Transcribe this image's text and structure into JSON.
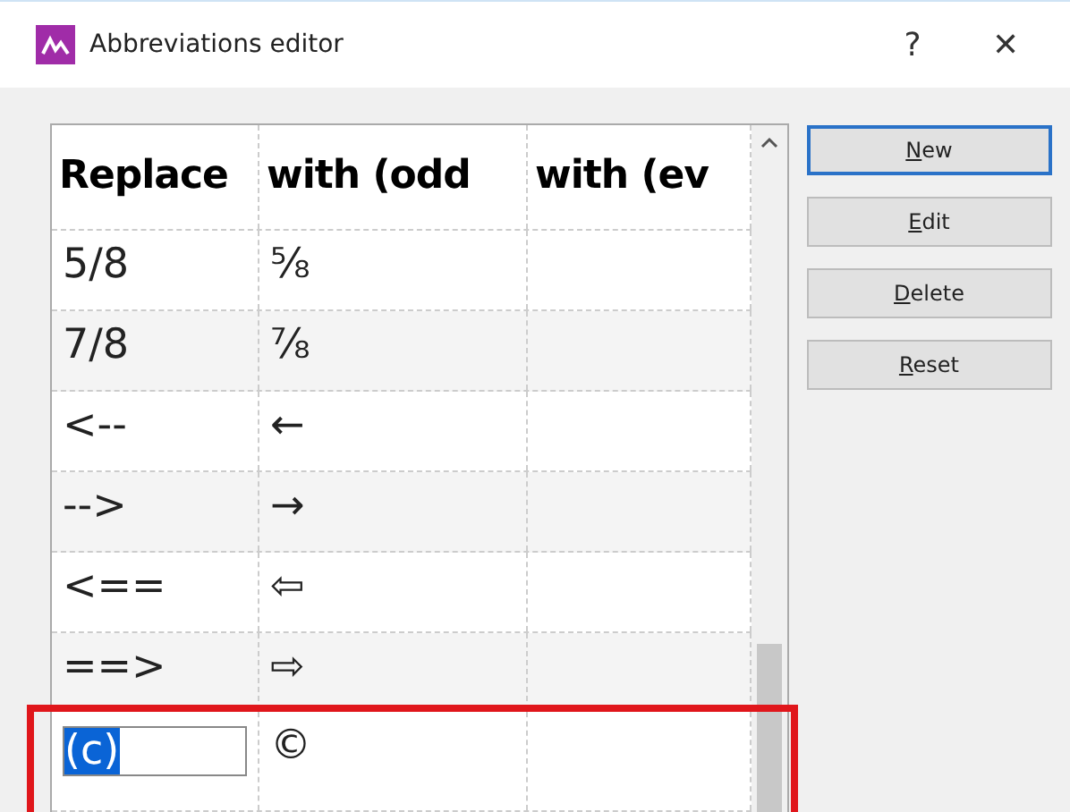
{
  "window": {
    "title": "Abbreviations editor",
    "help": "?",
    "close": "✕"
  },
  "table": {
    "columns": [
      "Replace",
      "with (odd",
      "with (ev"
    ],
    "rows": [
      {
        "cells": [
          "5/8",
          "⅝",
          ""
        ],
        "editing": false
      },
      {
        "cells": [
          "7/8",
          "⅞",
          ""
        ],
        "editing": false
      },
      {
        "cells": [
          "<--",
          "←",
          ""
        ],
        "editing": false
      },
      {
        "cells": [
          "-->",
          "→",
          ""
        ],
        "editing": false
      },
      {
        "cells": [
          "<==",
          "⇦",
          ""
        ],
        "editing": false
      },
      {
        "cells": [
          "==>",
          "⇨",
          ""
        ],
        "editing": false
      },
      {
        "cells": [
          "(c)",
          "©",
          ""
        ],
        "editing": true
      }
    ]
  },
  "buttons": [
    {
      "label": "New",
      "selected": true
    },
    {
      "label": "Edit",
      "selected": false
    },
    {
      "label": "Delete",
      "selected": false
    },
    {
      "label": "Reset",
      "selected": false
    }
  ]
}
